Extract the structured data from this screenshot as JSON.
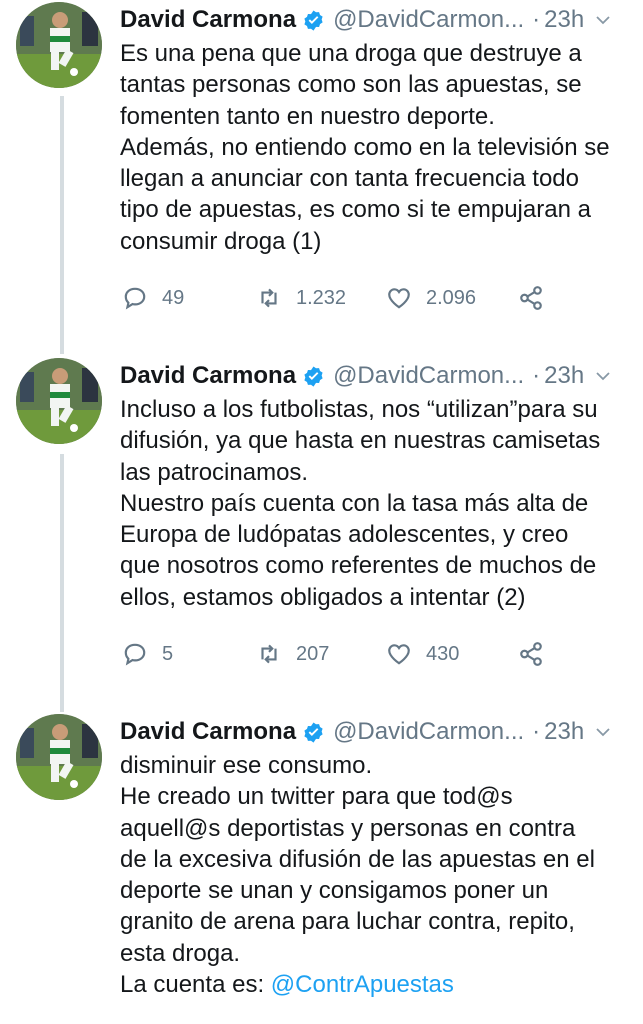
{
  "tweets": [
    {
      "author": "David Carmona",
      "handle": "@DavidCarmon...",
      "separator": "·",
      "time": "23h",
      "text": "Es una pena que una droga que destruye a\ntantas personas como son las apuestas, se\nfomenten tanto en nuestro deporte.\nAdemás, no entiendo como en la televisión se\nllegan a anunciar con tanta frecuencia todo\ntipo de apuestas, es como si te empujaran a\nconsumir droga (1)",
      "replies": "49",
      "retweets": "1.232",
      "likes": "2.096"
    },
    {
      "author": "David Carmona",
      "handle": "@DavidCarmon...",
      "separator": "·",
      "time": "23h",
      "text": "Incluso a los futbolistas, nos “utilizan”para su\ndifusión, ya que hasta en nuestras camisetas\nlas patrocinamos.\nNuestro país cuenta con la tasa más alta de\nEuropa de ludópatas adolescentes, y creo\nque nosotros como referentes de muchos de\nellos, estamos obligados a intentar (2)",
      "replies": "5",
      "retweets": "207",
      "likes": "430"
    },
    {
      "author": "David Carmona",
      "handle": "@DavidCarmon...",
      "separator": "·",
      "time": "23h",
      "text": "disminuir ese consumo.\nHe creado un twitter para que tod@s\naquell@s deportistas y personas en contra\nde la excesiva difusión de las apuestas en el\ndeporte se unan y consigamos poner un\ngranito de arena para luchar contra, repito,\nesta droga.",
      "text_prefix": "La cuenta es: ",
      "mention": "@ContrApuestas"
    }
  ],
  "colors": {
    "text": "#14171a",
    "secondary": "#657786",
    "link": "#1da1f2",
    "verified": "#1da1f2",
    "thread_line": "#d5dce0"
  },
  "icons": [
    "verified-badge-icon",
    "chevron-down-icon",
    "reply-icon",
    "retweet-icon",
    "like-icon",
    "share-icon"
  ]
}
